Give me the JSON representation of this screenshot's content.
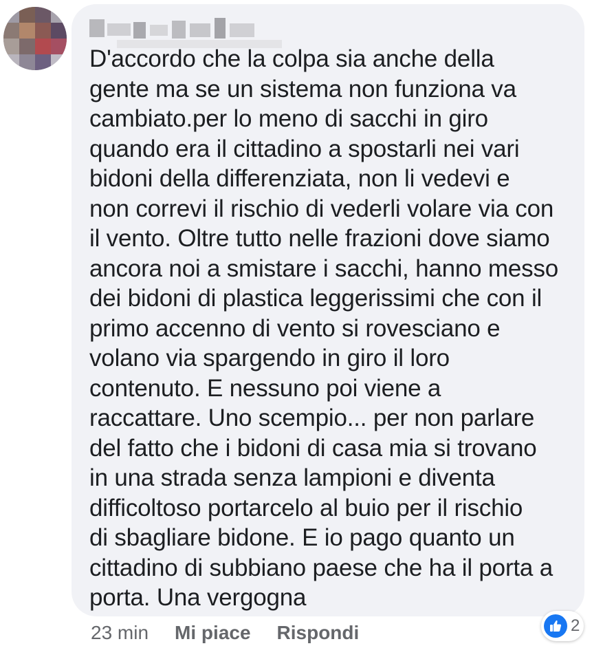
{
  "comment": {
    "text": "D'accordo che la colpa sia anche della\ngente ma se un sistema non funziona va\ncambiato.per lo meno di sacchi in giro\nquando era il cittadino a spostarli nei vari\nbidoni della differenziata, non li vedevi e\nnon correvi il rischio di vederli volare via con\nil vento. Oltre tutto nelle frazioni dove siamo\nancora noi a smistare i sacchi, hanno messo\ndei bidoni di plastica leggerissimi che con il\nprimo accenno di vento si rovesciano e\nvolano via spargendo in giro il loro\ncontenuto. E nessuno poi viene a\nraccattare. Uno scempio... per non parlare\ndel fatto che i bidoni di casa mia si trovano\nin una strada senza lampioni e diventa\ndifficoltoso portarcelo al buio per il rischio\ndi sbagliare bidone. E io pago quanto un\ncittadino di subbiano paese che ha il porta a\nporta. Una vergogna"
  },
  "footer": {
    "timestamp": "23 min",
    "like_label": "Mi piace",
    "reply_label": "Rispondi"
  },
  "reactions": {
    "icon": "like-icon",
    "count": "2",
    "color": "#1877f2"
  },
  "colors": {
    "bubble": "#f1f2f6",
    "text": "#1c1e21",
    "secondary": "#65676b"
  }
}
